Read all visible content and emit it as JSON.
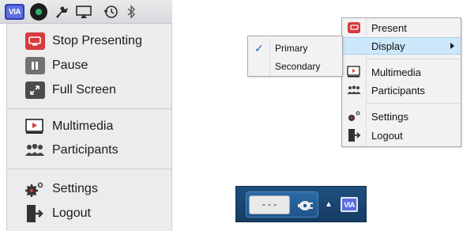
{
  "mac_menubar": {
    "app_icon_label": "VIA",
    "icons": [
      "via-app-icon",
      "green-circle-icon",
      "tools-icon",
      "airplay-icon",
      "time-machine-icon",
      "bluetooth-icon"
    ]
  },
  "mac_dropdown": {
    "items": [
      {
        "label": "Stop Presenting",
        "icon": "present-icon"
      },
      {
        "label": "Pause",
        "icon": "pause-icon"
      },
      {
        "label": "Full Screen",
        "icon": "fullscreen-icon"
      },
      {
        "label": "Multimedia",
        "icon": "multimedia-icon"
      },
      {
        "label": "Participants",
        "icon": "participants-icon"
      },
      {
        "label": "Settings",
        "icon": "settings-icon"
      },
      {
        "label": "Logout",
        "icon": "logout-icon"
      }
    ]
  },
  "win_menu": {
    "items": [
      {
        "label": "Present",
        "icon": "present-icon"
      },
      {
        "label": "Display",
        "icon": "",
        "has_submenu": true
      },
      {
        "label": "Multimedia",
        "icon": "multimedia-icon"
      },
      {
        "label": "Participants",
        "icon": "participants-icon"
      },
      {
        "label": "Settings",
        "icon": "settings-icon"
      },
      {
        "label": "Logout",
        "icon": "logout-icon"
      }
    ],
    "highlight_color": "#cde8fb"
  },
  "display_submenu": {
    "items": [
      {
        "label": "Primary",
        "checked": true,
        "check_glyph": "✓"
      },
      {
        "label": "Secondary",
        "checked": false
      }
    ]
  },
  "taskbar": {
    "battery_text": "---",
    "tray_arrow": "▲",
    "app_icon_label": "VIA"
  },
  "colors": {
    "via_blue": "#5b6ee0",
    "present_red": "#d63a3a",
    "taskbar_blue": "#1f4f7f"
  }
}
